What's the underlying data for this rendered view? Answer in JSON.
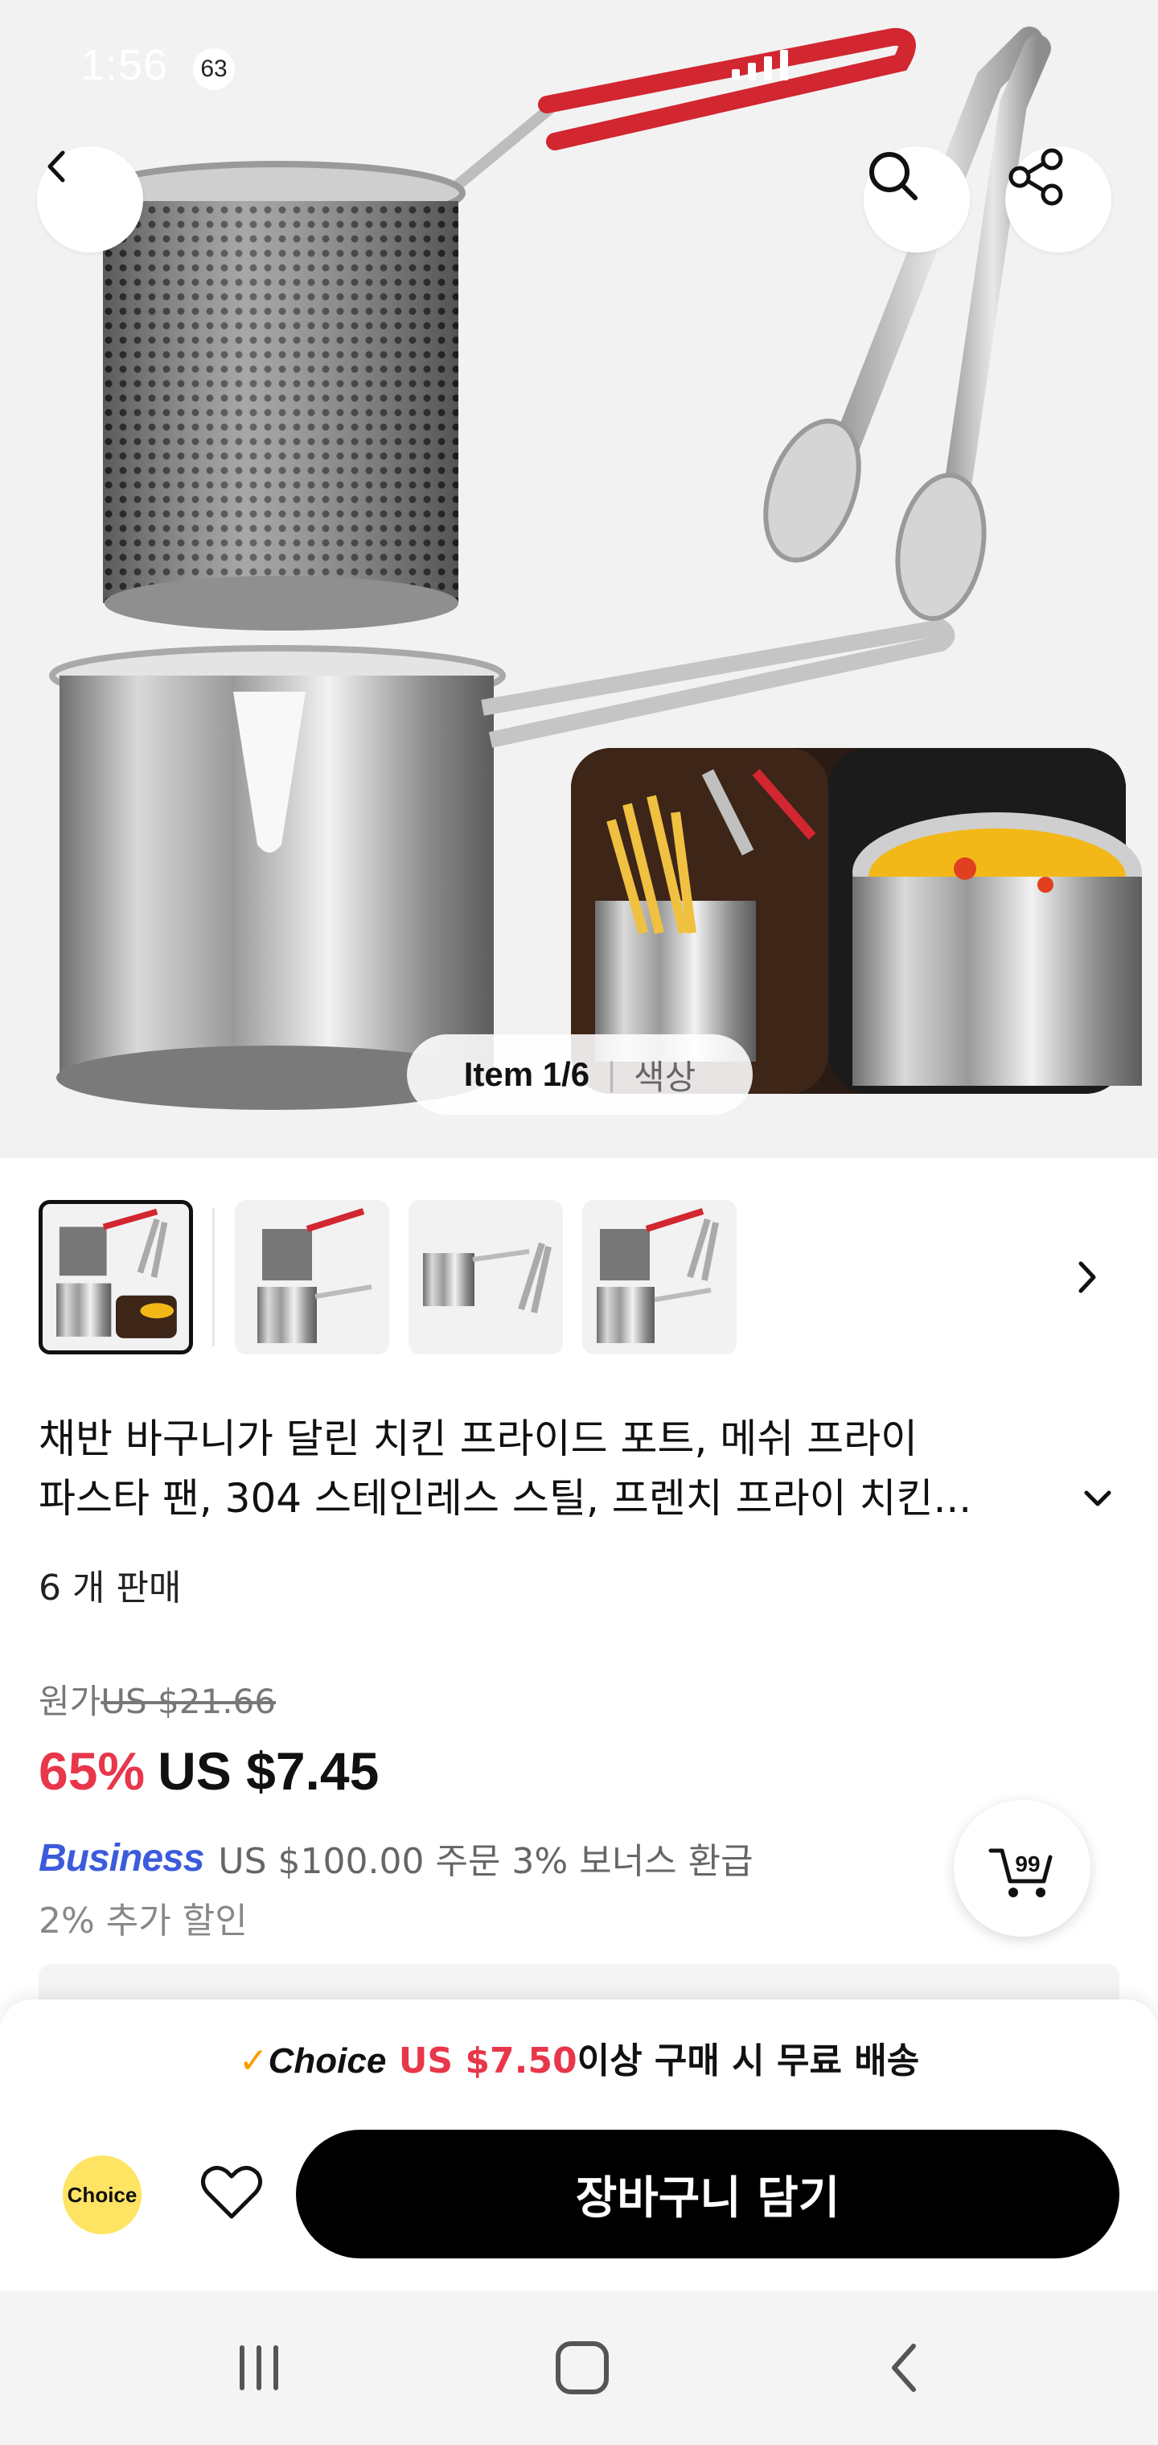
{
  "status_bar": {
    "time": "1:56",
    "notification_count": "63"
  },
  "hero": {
    "item_label": "Item 1/6",
    "option_label": "색상"
  },
  "icons": {
    "back": "chevron-left-icon",
    "search": "search-icon",
    "share": "share-icon",
    "next": "chevron-right-icon",
    "expand": "chevron-down-icon",
    "cart": "cart-icon",
    "wishlist": "heart-icon"
  },
  "product": {
    "title_line1": "채반 바구니가 달린 치킨 프라이드 포트, 메쉬 프라이",
    "title_line2": "파스타 팬, 304 스테인레스 스틸, 프렌치 프라이 치킨...",
    "sold": "6 개 판매",
    "original_label": "원가",
    "original_price": "US $21.66",
    "discount": "65%",
    "price": "US $7.45",
    "business_logo": "Business",
    "business_text": "US $100.00 주문 3% 보너스 환급",
    "extra_discount": "2% 추가 할인"
  },
  "cart_fab": {
    "badge": "99"
  },
  "bottom": {
    "ship_check": "✓",
    "ship_choice": "Choice",
    "ship_amount": "US $7.50",
    "ship_text": "이상 구매 시 무료 배송",
    "choice_logo": "Choice",
    "add_to_cart": "장바구니 담기"
  },
  "colors": {
    "accent_red": "#e8364a",
    "choice_yellow": "#ffe363",
    "business_blue": "#3b5bdb",
    "pot_handle_red": "#d22630"
  }
}
